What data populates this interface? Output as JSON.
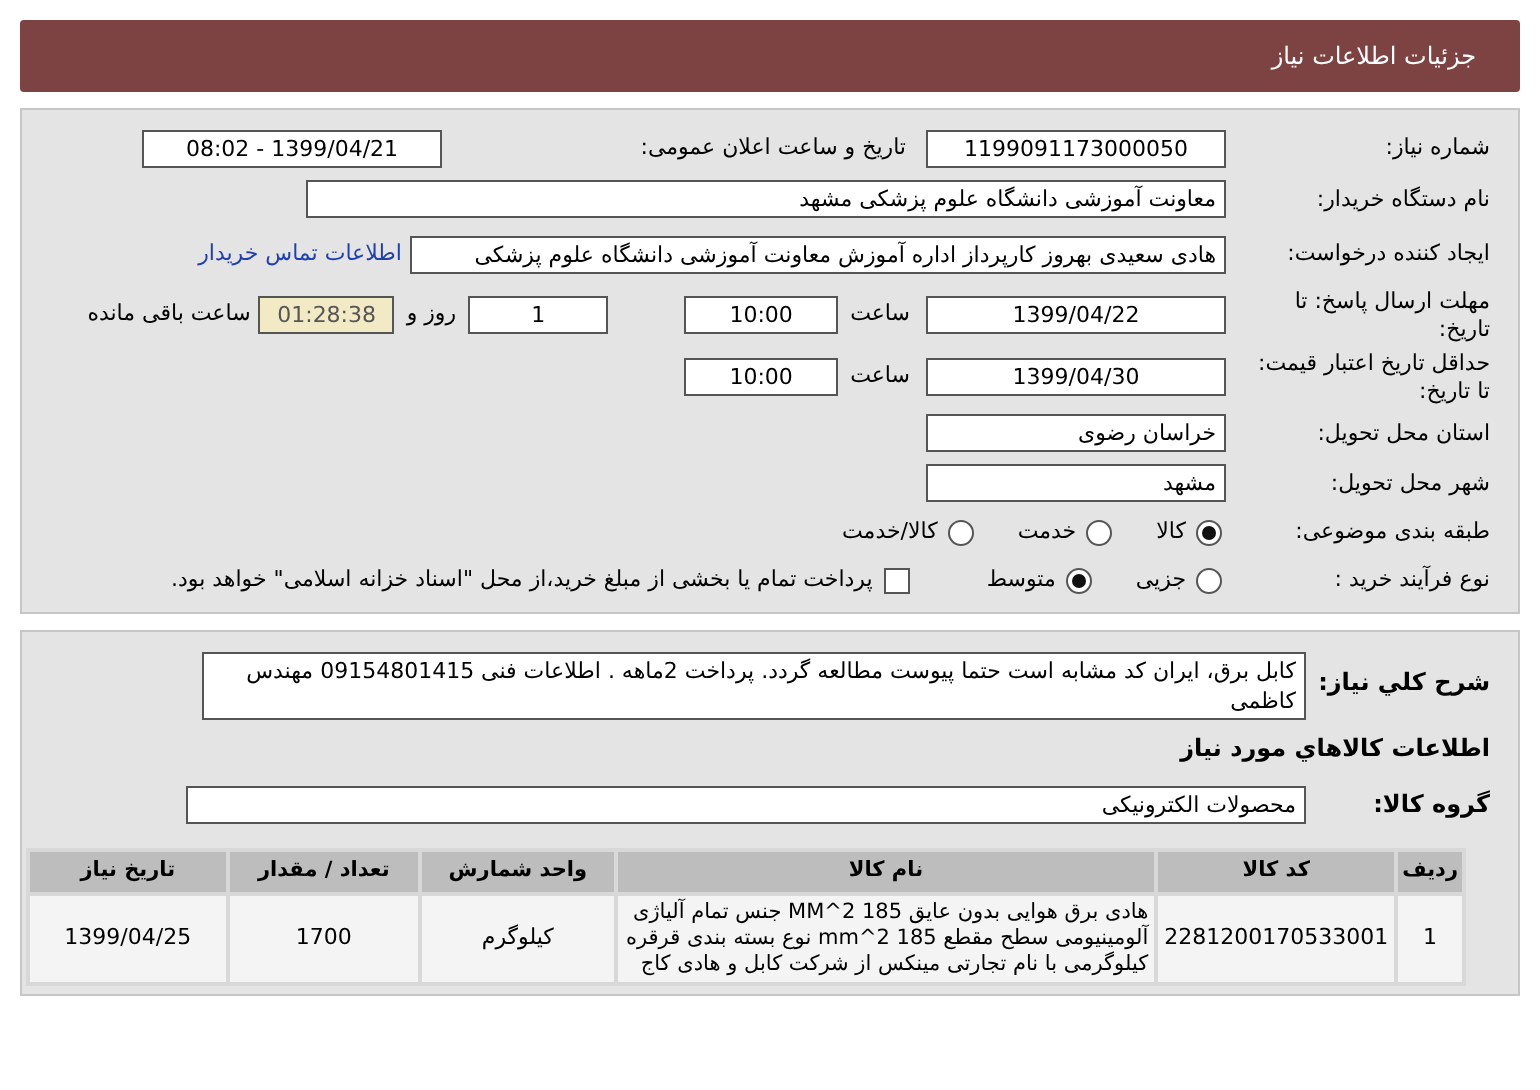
{
  "header": {
    "title": "جزئیات اطلاعات نیاز"
  },
  "need_number": {
    "label": "شماره نیاز:",
    "value": "1199091173000050"
  },
  "announce_date": {
    "label": "تاریخ و ساعت اعلان عمومی:",
    "value": "1399/04/21 - 08:02"
  },
  "buyer_org": {
    "label": "نام دستگاه خریدار:",
    "value": "معاونت آموزشی دانشگاه علوم پزشکی مشهد"
  },
  "requester": {
    "label": "ایجاد کننده درخواست:",
    "value": "هادی سعیدی بهروز کارپرداز اداره آموزش معاونت آموزشی دانشگاه علوم پزشکی",
    "link": "اطلاعات تماس خریدار"
  },
  "reply_deadline": {
    "label": "مهلت ارسال پاسخ: تا تاریخ:",
    "date": "1399/04/22",
    "time_label": "ساعت",
    "time": "10:00",
    "days": "1",
    "days_label": "روز و",
    "remaining": "01:28:38",
    "remaining_label": "ساعت باقی مانده"
  },
  "price_validity": {
    "label": "حداقل تاریخ اعتبار قیمت: تا تاریخ:",
    "date": "1399/04/30",
    "time_label": "ساعت",
    "time": "10:00"
  },
  "province": {
    "label": "استان محل تحویل:",
    "value": "خراسان رضوی"
  },
  "city": {
    "label": "شهر محل تحویل:",
    "value": "مشهد"
  },
  "category": {
    "label": "طبقه بندی موضوعی:",
    "options": [
      {
        "label": "کالا",
        "selected": true
      },
      {
        "label": "خدمت",
        "selected": false
      },
      {
        "label": "کالا/خدمت",
        "selected": false
      }
    ]
  },
  "process": {
    "label": "نوع فرآیند خرید :",
    "options": [
      {
        "label": "جزیی",
        "selected": false
      },
      {
        "label": "متوسط",
        "selected": true
      }
    ],
    "payment": {
      "label": "پرداخت تمام یا بخشی از مبلغ خرید،از محل \"اسناد خزانه اسلامی\" خواهد بود.",
      "checked": false
    }
  },
  "description": {
    "label": "شرح کلي نياز:",
    "value": "کابل برق، ایران کد مشابه است حتما پیوست مطالعه گردد. پرداخت 2ماهه . اطلاعات فنی 09154801415 مهندس کاظمی"
  },
  "goods_heading": "اطلاعات کالاهاي مورد نياز",
  "goods_group": {
    "label": "گروه کالا:",
    "value": "محصولات الکترونیکی"
  },
  "table": {
    "columns": [
      "ردیف",
      "کد کالا",
      "نام کالا",
      "واحد شمارش",
      "تعداد / مقدار",
      "تاریخ نیاز"
    ],
    "rows": [
      [
        "1",
        "2281200170533001",
        "هادی برق هوایی بدون عایق 185 MM^2 جنس تمام آلیاژی آلومینیومی سطح مقطع 185 mm^2 نوع بسته بندی قرقره کیلوگرمی با نام تجارتی مینکس از شرکت کابل و هادی کاج",
        "کیلوگرم",
        "1700",
        "1399/04/25"
      ]
    ]
  }
}
